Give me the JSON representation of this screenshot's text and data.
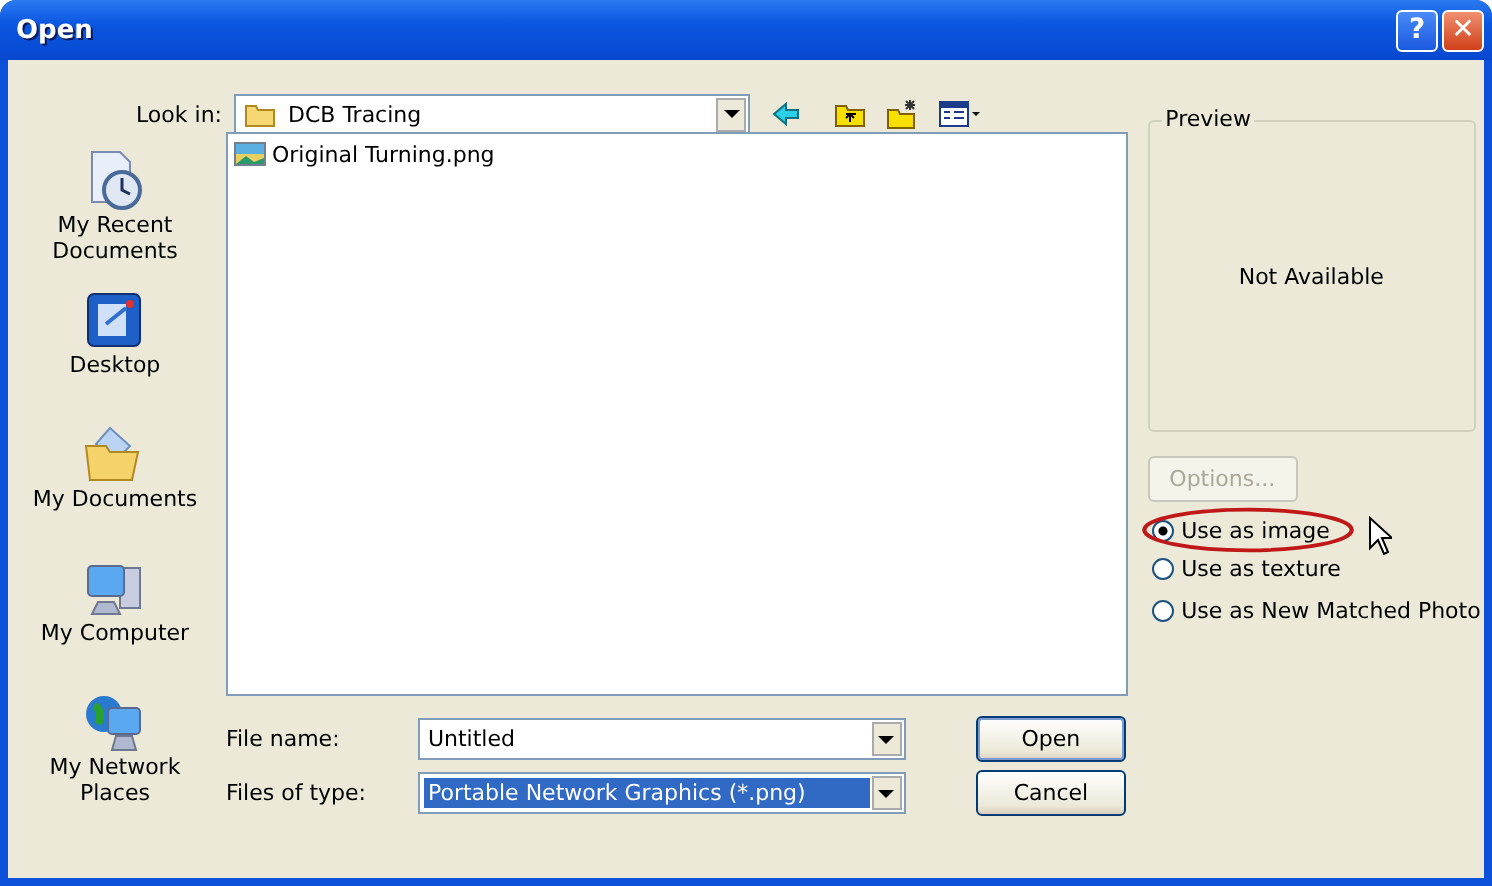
{
  "window": {
    "title": "Open",
    "buttons": [
      "?",
      "✕"
    ]
  },
  "look_in": {
    "label": "Look in:",
    "value": "DCB Tracing"
  },
  "places": [
    {
      "kind": "recent",
      "label": "My Recent Documents"
    },
    {
      "kind": "desktop",
      "label": "Desktop"
    },
    {
      "kind": "documents",
      "label": "My Documents"
    },
    {
      "kind": "computer",
      "label": "My Computer"
    },
    {
      "kind": "network",
      "label": "My Network Places"
    }
  ],
  "files": [
    {
      "name": "Original Turning.png",
      "selected": false
    }
  ],
  "preview": {
    "title": "Preview",
    "text": "Not Available"
  },
  "options_button": {
    "label": "Options...",
    "disabled": true
  },
  "radios": [
    {
      "label": "Use as image",
      "selected": true,
      "circled": true
    },
    {
      "label": "Use as texture",
      "selected": false,
      "circled": false
    },
    {
      "label": "Use as New Matched Photo",
      "selected": false,
      "circled": false
    }
  ],
  "file_name": {
    "label": "File name:",
    "value": "Untitled",
    "highlighted": false
  },
  "file_type": {
    "label": "Files of type:",
    "value": "Portable Network Graphics (*.png)",
    "highlighted": true
  },
  "buttons": [
    "Open",
    "Cancel"
  ]
}
